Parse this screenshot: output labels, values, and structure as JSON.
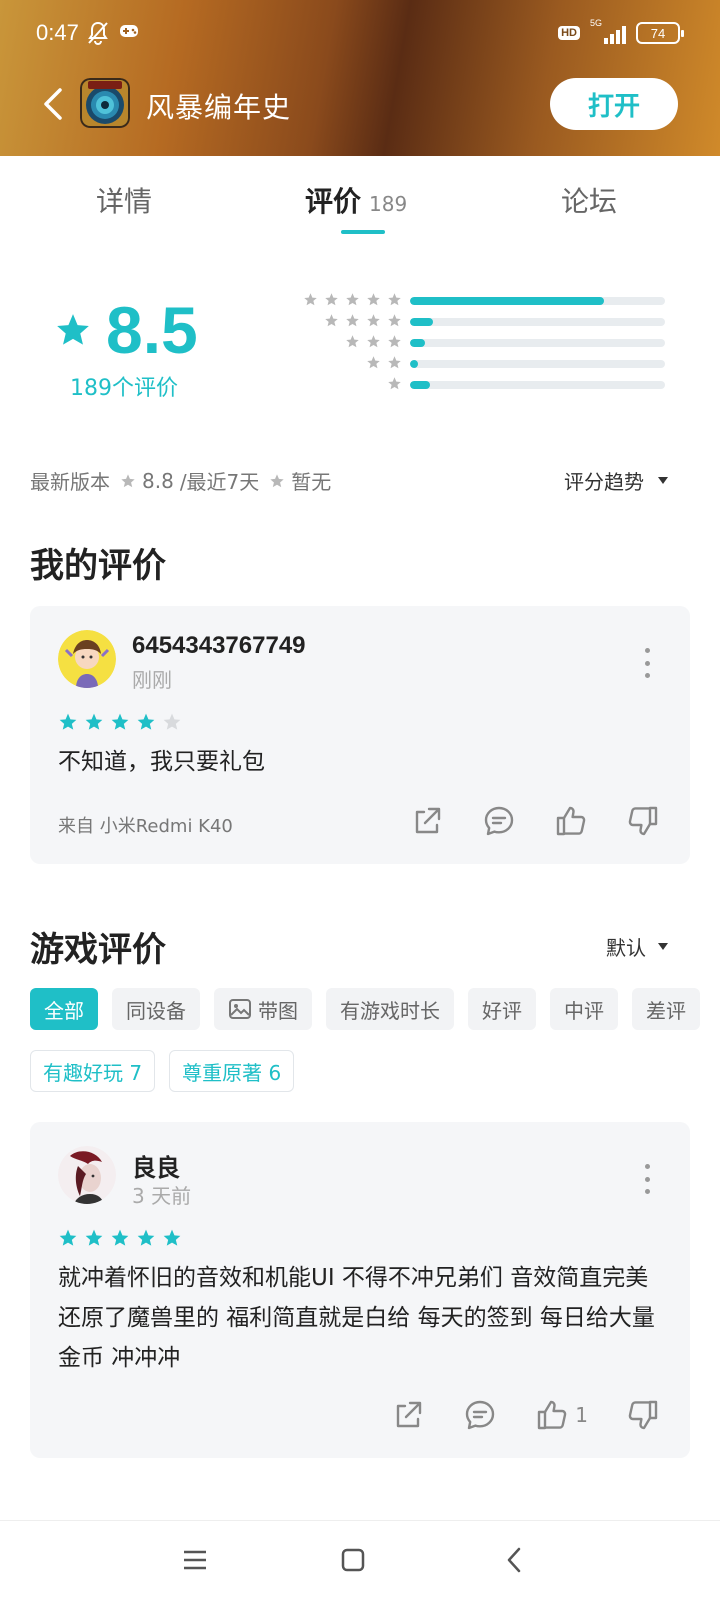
{
  "status": {
    "time": "0:47",
    "hd": "HD",
    "network": "5G",
    "battery": "74"
  },
  "app": {
    "name": "风暴编年史",
    "open_label": "打开",
    "accent": "#1fbfc7"
  },
  "tabs": [
    {
      "label": "详情"
    },
    {
      "label": "评价",
      "count": "189"
    },
    {
      "label": "论坛"
    }
  ],
  "rating": {
    "score": "8.5",
    "count_label": "189个评价",
    "distribution": [
      {
        "stars": 5,
        "fraction": 0.76
      },
      {
        "stars": 4,
        "fraction": 0.09
      },
      {
        "stars": 3,
        "fraction": 0.06
      },
      {
        "stars": 2,
        "fraction": 0.03
      },
      {
        "stars": 1,
        "fraction": 0.08
      }
    ]
  },
  "version": {
    "prefix": "最新版本",
    "latest_score": "8.8",
    "sep": "/最近7天",
    "recent": "暂无",
    "trend_label": "评分趋势"
  },
  "my_review": {
    "section_title": "我的评价",
    "username": "6454343767749",
    "time": "刚刚",
    "stars": 4,
    "text": "不知道，我只要礼包",
    "device": "来自 小米Redmi K40"
  },
  "game_reviews": {
    "section_title": "游戏评价",
    "sort_label": "默认",
    "filters": [
      "全部",
      "同设备",
      "带图",
      "有游戏时长",
      "好评",
      "中评",
      "差评"
    ],
    "tags": [
      "有趣好玩 7",
      "尊重原著 6"
    ],
    "items": [
      {
        "username": "良良",
        "time": "3 天前",
        "stars": 5,
        "text": "就冲着怀旧的音效和机能UI 不得不冲兄弟们 音效简直完美还原了魔兽里的 福利简直就是白给 每天的签到 每日给大量金币 冲冲冲",
        "likes": "1"
      }
    ]
  }
}
